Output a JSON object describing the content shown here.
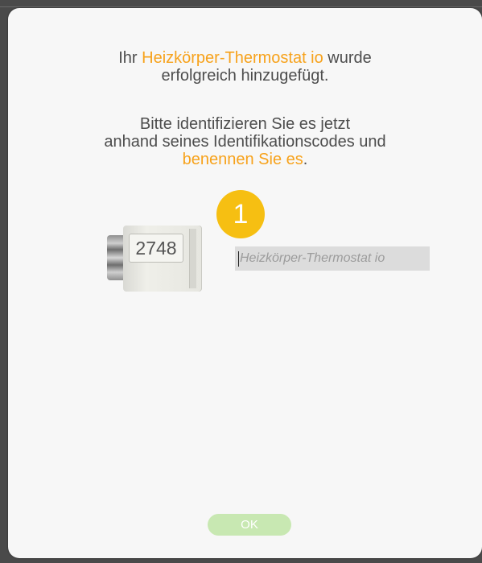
{
  "message": {
    "line1_prefix": "Ihr ",
    "device_name": "Heizkörper-Thermostat io",
    "line1_suffix": " wurde",
    "line2": "erfolgreich hinzugefügt.",
    "instruction_line1": "Bitte identifizieren Sie es jetzt",
    "instruction_line2": "anhand seines Identifikationscodes und",
    "instruction_accent": "benennen Sie es",
    "instruction_end": "."
  },
  "step_badge": "1",
  "device": {
    "id_code": "2748"
  },
  "name_field": {
    "placeholder": "Heizkörper-Thermostat io",
    "value": ""
  },
  "ok_button": {
    "label": "OK"
  },
  "colors": {
    "accent": "#f7a21b",
    "badge": "#f6bf12",
    "ok_button": "#c8e8b2",
    "text": "#4d4d4d"
  }
}
